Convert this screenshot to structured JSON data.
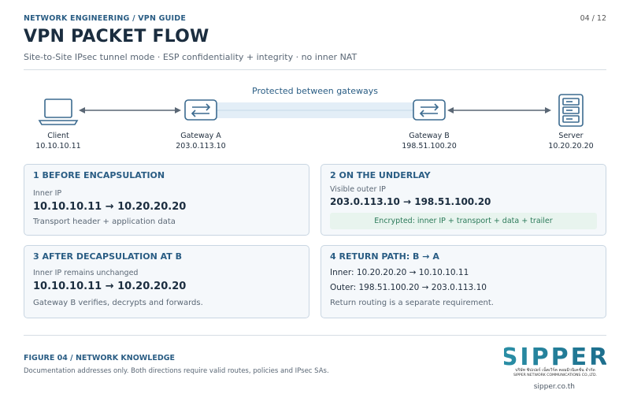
{
  "header": {
    "kicker": "NETWORK ENGINEERING / VPN GUIDE",
    "page": "04 / 12",
    "title": "VPN PACKET FLOW",
    "subtitle": "Site-to-Site IPsec tunnel mode · ESP confidentiality + integrity · no inner NAT"
  },
  "diagram": {
    "tunnel_label": "Protected between gateways",
    "nodes": [
      {
        "name": "Client",
        "ip": "10.10.10.11",
        "icon": "laptop-icon"
      },
      {
        "name": "Gateway A",
        "ip": "203.0.113.10",
        "icon": "gateway-icon"
      },
      {
        "name": "Gateway B",
        "ip": "198.51.100.20",
        "icon": "gateway-icon"
      },
      {
        "name": "Server",
        "ip": "10.20.20.20",
        "icon": "server-icon"
      }
    ]
  },
  "cards": {
    "before": {
      "title": "1 BEFORE ENCAPSULATION",
      "label": "Inner IP",
      "flow": "10.10.10.11 → 10.20.20.20",
      "note": "Transport header + application data"
    },
    "underlay": {
      "title": "2 ON THE UNDERLAY",
      "label": "Visible outer IP",
      "flow": "203.0.113.10 → 198.51.100.20",
      "encrypted": "Encrypted: inner IP + transport + data + trailer"
    },
    "after": {
      "title": "3 AFTER DECAPSULATION AT B",
      "label": "Inner IP remains unchanged",
      "flow": "10.10.10.11 → 10.20.20.20",
      "note": "Gateway B verifies, decrypts and forwards."
    },
    "return": {
      "title": "4 RETURN PATH: B → A",
      "inner": "Inner: 10.20.20.20 → 10.10.10.11",
      "outer": "Outer: 198.51.100.20 → 203.0.113.10",
      "note": "Return routing is a separate requirement."
    }
  },
  "footer": {
    "figure": "FIGURE 04 / NETWORK KNOWLEDGE",
    "note": "Documentation addresses only. Both directions require valid routes, policies and IPsec SAs."
  },
  "logo": {
    "brand": "SIPPER",
    "thai": "บริษัท ซิปเปอร์ เน็ตเวิร์ค คอมมิวนิเคชั่น จำกัด",
    "english": "SIPPER NETWORK COMMUNICATIONS CO.,LTD.",
    "site": "sipper.co.th"
  },
  "colors": {
    "accent": "#2a5d84",
    "icon": "#3b6a8f",
    "tunnel": "#e3eef7",
    "encrypted_bg": "#e8f4ee",
    "encrypted_text": "#2c7a5a"
  }
}
